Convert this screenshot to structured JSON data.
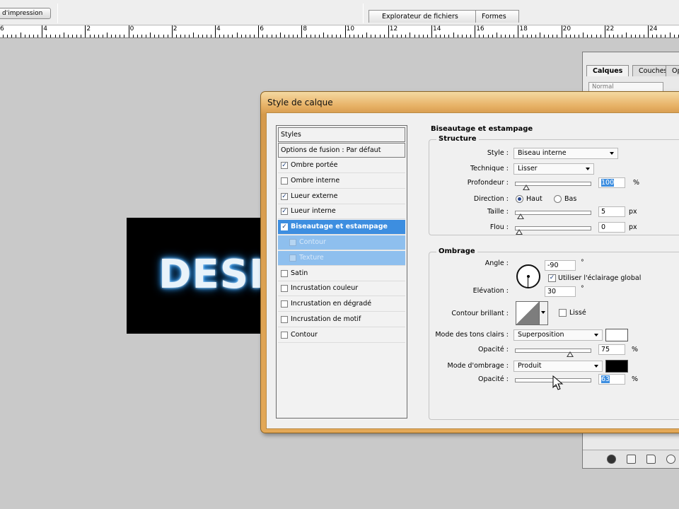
{
  "toolbar": {
    "print_label": "d'impression"
  },
  "workspace_tabs": [
    "Explorateur de fichiers",
    "Formes"
  ],
  "ruler": {
    "labels": [
      "6",
      "4",
      "2",
      "0",
      "2",
      "4",
      "6",
      "8",
      "10",
      "12",
      "14",
      "16",
      "18",
      "20",
      "22",
      "24"
    ]
  },
  "canvas": {
    "text": "DESI"
  },
  "layers_panel": {
    "tabs": [
      "Calques",
      "Couches",
      "Op"
    ],
    "blend_mode": "Normal"
  },
  "dialog": {
    "title": "Style de calque",
    "styles_header": "Styles",
    "blending_options": "Options de fusion : Par défaut",
    "items": [
      {
        "label": "Ombre portée",
        "checked": true
      },
      {
        "label": "Ombre interne",
        "checked": false
      },
      {
        "label": "Lueur externe",
        "checked": true
      },
      {
        "label": "Lueur interne",
        "checked": true
      },
      {
        "label": "Biseautage et estampage",
        "checked": true,
        "selected": true
      },
      {
        "label": "Contour",
        "checked": false,
        "sub": true
      },
      {
        "label": "Texture",
        "checked": false,
        "sub": true
      },
      {
        "label": "Satin",
        "checked": false
      },
      {
        "label": "Incrustation couleur",
        "checked": false
      },
      {
        "label": "Incrustation en dégradé",
        "checked": false
      },
      {
        "label": "Incrustation de motif",
        "checked": false
      },
      {
        "label": "Contour",
        "checked": false
      }
    ],
    "section_title": "Biseautage et estampage",
    "structure": {
      "title": "Structure",
      "style_label": "Style :",
      "style_value": "Biseau interne",
      "technique_label": "Technique :",
      "technique_value": "Lisser",
      "depth_label": "Profondeur :",
      "depth_value": "100",
      "depth_unit": "%",
      "depth_level": 0.1,
      "direction_label": "Direction :",
      "dir_up": "Haut",
      "dir_down": "Bas",
      "size_label": "Taille :",
      "size_value": "5",
      "size_unit": "px",
      "size_level": 0.02,
      "soften_label": "Flou :",
      "soften_value": "0",
      "soften_unit": "px",
      "soften_level": 0.0
    },
    "shading": {
      "title": "Ombrage",
      "angle_label": "Angle :",
      "angle_value": "-90",
      "angle_unit": "°",
      "global_light_label": "Utiliser l'éclairage global",
      "altitude_label": "Elévation :",
      "altitude_value": "30",
      "altitude_unit": "°",
      "gloss_label": "Contour brillant :",
      "antialias_label": "Lissé",
      "highlight_label": "Mode des tons clairs :",
      "highlight_mode": "Superposition",
      "highlight_color": "#ffffff",
      "opacity_label": "Opacité :",
      "highlight_opacity": "75",
      "highlight_level": 0.75,
      "shadow_label": "Mode d'ombrage :",
      "shadow_mode": "Produit",
      "shadow_color": "#000000",
      "shadow_opacity": "63",
      "shadow_level": 0.55,
      "percent": "%"
    }
  }
}
